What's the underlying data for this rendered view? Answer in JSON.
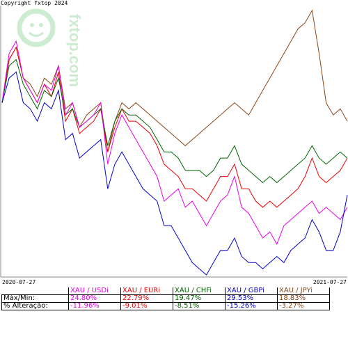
{
  "copyright": "Copyright fxtop 2024",
  "watermark": "fxtop.com",
  "chart_data": {
    "type": "line",
    "x_start": "2020-07-27",
    "x_end": "2021-07-27",
    "grid": false,
    "series": [
      {
        "name": "XAU / USDi",
        "color": "#e800e8",
        "max_min": "24.80%",
        "change": "-11.96%",
        "values": [
          100,
          108,
          110,
          104,
          102,
          100,
          103,
          102,
          106,
          98,
          100,
          96,
          97,
          98,
          100,
          90,
          95,
          98,
          96,
          94,
          92,
          90,
          88,
          84,
          85,
          86,
          83,
          84,
          82,
          80,
          82,
          84,
          85,
          88,
          83,
          82,
          80,
          78,
          79,
          77,
          80,
          81,
          82,
          83,
          84,
          82,
          83,
          82,
          81,
          83
        ]
      },
      {
        "name": "XAU / EURi",
        "color": "#e80000",
        "max_min": "22.79%",
        "change": "-9.01%",
        "values": [
          100,
          107,
          109,
          104,
          102,
          100,
          103,
          101,
          105,
          97,
          99,
          95,
          96,
          97,
          99,
          92,
          96,
          99,
          97,
          97,
          96,
          95,
          93,
          90,
          89,
          88,
          86,
          86,
          85,
          84,
          86,
          88,
          88,
          90,
          86,
          86,
          84,
          83,
          84,
          83,
          84,
          85,
          86,
          88,
          91,
          88,
          87,
          88,
          89,
          91
        ]
      },
      {
        "name": "XAU / CHFi",
        "color": "#006400",
        "max_min": "19.47%",
        "change": "-8.51%",
        "values": [
          100,
          106,
          107,
          103,
          101,
          99,
          102,
          101,
          104,
          98,
          99,
          96,
          97,
          98,
          99,
          93,
          97,
          99,
          98,
          98,
          97,
          96,
          94,
          92,
          92,
          91,
          89,
          89,
          89,
          88,
          89,
          91,
          91,
          93,
          90,
          89,
          88,
          87,
          88,
          87,
          88,
          89,
          90,
          91,
          93,
          91,
          90,
          91,
          92,
          91
        ]
      },
      {
        "name": "XAU / GBPi",
        "color": "#0000cc",
        "max_min": "29.53%",
        "change": "-15.26%",
        "values": [
          100,
          104,
          105,
          100,
          99,
          97,
          100,
          99,
          102,
          94,
          95,
          91,
          92,
          93,
          94,
          86,
          90,
          92,
          90,
          88,
          86,
          85,
          84,
          80,
          80,
          78,
          76,
          74,
          73,
          72,
          74,
          76,
          76,
          78,
          75,
          74,
          74,
          73,
          74,
          75,
          74,
          76,
          77,
          78,
          81,
          79,
          76,
          76,
          79,
          85
        ]
      },
      {
        "name": "XAU / JPYi",
        "color": "#8b4513",
        "max_min": "18.83%",
        "change": "-3.27%",
        "values": [
          100,
          107,
          109,
          104,
          103,
          101,
          104,
          103,
          106,
          99,
          100,
          96,
          98,
          99,
          100,
          92,
          97,
          100,
          99,
          100,
          99,
          98,
          97,
          96,
          95,
          94,
          93,
          94,
          95,
          96,
          97,
          98,
          99,
          100,
          99,
          98,
          100,
          102,
          104,
          106,
          108,
          110,
          112,
          113,
          115,
          108,
          100,
          98,
          99,
          97
        ]
      }
    ],
    "xlabel": "",
    "ylabel": ""
  },
  "table": {
    "row_labels": [
      "Máx/Min:",
      "% Alteração:"
    ]
  }
}
